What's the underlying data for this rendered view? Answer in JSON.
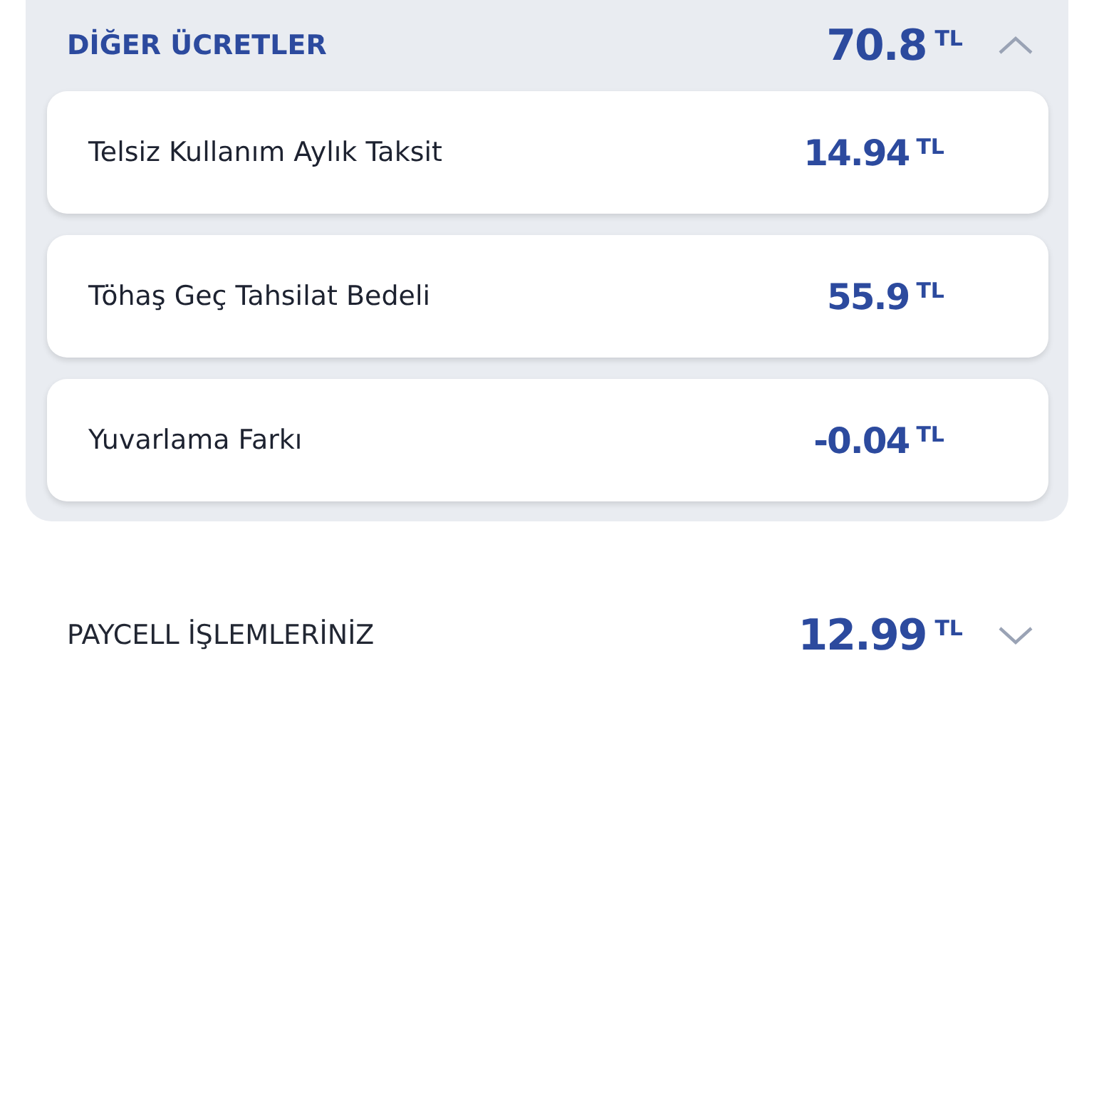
{
  "sections": [
    {
      "title": "DİĞER ÜCRETLER",
      "amount": "70.8",
      "unit": "TL",
      "expanded": true,
      "items": [
        {
          "label": "Telsiz Kullanım Aylık Taksit",
          "amount": "14.94",
          "unit": "TL"
        },
        {
          "label": "Töhaş Geç Tahsilat Bedeli",
          "amount": "55.9",
          "unit": "TL"
        },
        {
          "label": "Yuvarlama Farkı",
          "amount": "-0.04",
          "unit": "TL"
        }
      ]
    },
    {
      "title": "PAYCELL İŞLEMLERİNİZ",
      "amount": "12.99",
      "unit": "TL",
      "expanded": false
    }
  ]
}
